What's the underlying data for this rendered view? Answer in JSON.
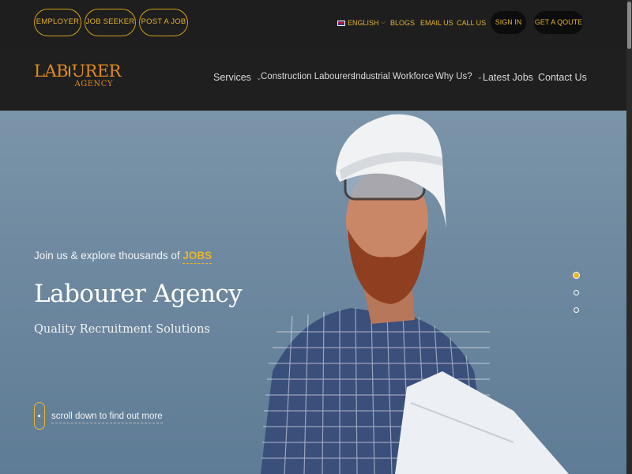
{
  "topbar": {
    "pills": [
      "EMPLOYER",
      "JOB SEEKER",
      "POST A JOB"
    ],
    "language": "ENGLISH",
    "links": [
      "BLOGS",
      "EMAIL US",
      "CALL US"
    ],
    "sign_in": "SIGN IN",
    "get_quote": "GET A QOUTE"
  },
  "logo": {
    "main_left": "LAB",
    "main_right": "URER",
    "sub": "AGENCY"
  },
  "nav": {
    "items": [
      {
        "label": "Services",
        "has_dropdown": true
      },
      {
        "label": "Construction Labourers",
        "has_dropdown": true
      },
      {
        "label": "Industrial Workforce",
        "has_dropdown": true
      },
      {
        "label": "Why Us?",
        "has_dropdown": true
      },
      {
        "label": "Latest Jobs",
        "has_dropdown": false
      },
      {
        "label": "Contact Us",
        "has_dropdown": false
      }
    ]
  },
  "hero": {
    "tagline_prefix": "Join us & explore thousands of ",
    "tagline_highlight": "JOBS",
    "title": "Labourer Agency",
    "subtitle": "Quality Recruitment Solutions",
    "scroll_text": "scroll down to find out more",
    "slides_count": 3,
    "active_slide": 1
  },
  "colors": {
    "accent": "#e8b52c",
    "dark": "#1e1e1e",
    "logo": "#e08a1d"
  }
}
